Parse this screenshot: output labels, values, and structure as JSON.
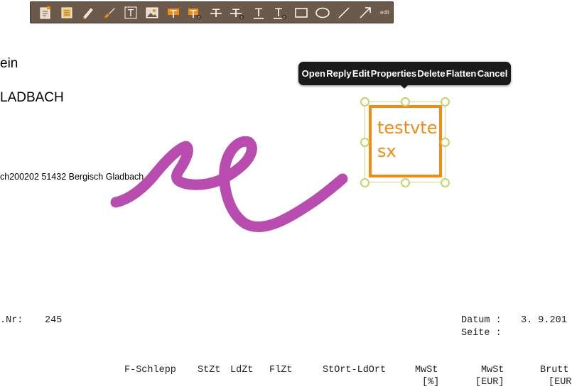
{
  "toolbar": {
    "tools": [
      {
        "icon": "note-icon",
        "name": "tool-note"
      },
      {
        "icon": "sticky-note-icon",
        "name": "tool-sticky-note"
      },
      {
        "icon": "pencil-icon",
        "name": "tool-pencil"
      },
      {
        "icon": "brush-icon",
        "name": "tool-brush"
      },
      {
        "icon": "text-box-icon",
        "name": "tool-text-box"
      },
      {
        "icon": "image-icon",
        "name": "tool-image"
      },
      {
        "icon": "highlight-text-icon",
        "name": "tool-highlight"
      },
      {
        "icon": "highlight-comment-icon",
        "name": "tool-highlight-comment"
      },
      {
        "icon": "strikeout-icon",
        "name": "tool-strikeout"
      },
      {
        "icon": "strikeout-comment-icon",
        "name": "tool-strikeout-comment"
      },
      {
        "icon": "underline-icon",
        "name": "tool-underline"
      },
      {
        "icon": "underline-comment-icon",
        "name": "tool-underline-comment"
      },
      {
        "icon": "rectangle-icon",
        "name": "tool-rectangle"
      },
      {
        "icon": "ellipse-icon",
        "name": "tool-ellipse"
      },
      {
        "icon": "line-icon",
        "name": "tool-line"
      },
      {
        "icon": "arrow-icon",
        "name": "tool-arrow"
      }
    ],
    "edit_label": "edit",
    "accent_color": "#f38a12"
  },
  "document": {
    "line1": "ein",
    "line2": "LADBACH",
    "address": "ch200202 51432 Bergisch Gladbach",
    "nr_label": ".Nr:",
    "nr_value": "245",
    "datum_label": "Datum :",
    "datum_value": "3. 9.201",
    "seite_label": "Seite :",
    "columns": [
      "F-Schlepp",
      "StZt",
      "LdZt",
      "FlZt",
      "StOrt-LdOrt",
      "MwSt",
      "MwSt",
      "Brutt"
    ],
    "column_units": [
      "[%]",
      "[EUR]",
      "[EUR"
    ]
  },
  "popup_menu": {
    "items": [
      "Open",
      "Reply",
      "Edit",
      "Properties",
      "Delete",
      "Flatten",
      "Cancel"
    ]
  },
  "annotation": {
    "text_line1": "testvte",
    "text_line2": "sx",
    "border_color": "#f38a12",
    "ink_color": "#b03aa6"
  }
}
